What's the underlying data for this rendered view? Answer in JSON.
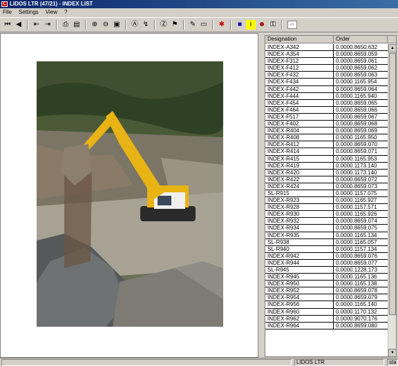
{
  "window": {
    "title": "LIDOS LTR (47/21) - INDEX LIST"
  },
  "menu": [
    "File",
    "Settings",
    "View",
    "?"
  ],
  "toolbar": {
    "icons": [
      "first-page-icon",
      "prev-page-icon",
      "prev-doc-icon",
      "next-doc-icon",
      "print-icon",
      "print-setup-icon",
      "zoom-in-icon",
      "zoom-out-icon",
      "fit-page-icon",
      "search-icon",
      "search-next-icon",
      "history-icon",
      "bookmark-icon",
      "note-icon",
      "export-icon",
      "highlight-icon",
      "info-icon",
      "settings-icon",
      "user-icon"
    ],
    "tab_glyph": "▭"
  },
  "list": {
    "headers": [
      "Designation",
      "Order"
    ],
    "rows": [
      [
        "INDEX-A342",
        "0.0000.8650.632"
      ],
      [
        "INDEX-A354",
        "0.0000.8659.059"
      ],
      [
        "INDEX-F312",
        "0.0000.8659.061"
      ],
      [
        "INDEX-F412",
        "0.0000.8659.062"
      ],
      [
        "INDEX-F432",
        "0.0000.8659.063"
      ],
      [
        "INDEX-F434",
        "0.0000.1165.954"
      ],
      [
        "INDEX-F442",
        "0.0000.8659.064"
      ],
      [
        "INDEX-F444",
        "0.0000.1165.940"
      ],
      [
        "INDEX-F454",
        "0.0000.8659.065"
      ],
      [
        "INDEX-F464",
        "0.0000.8659.066"
      ],
      [
        "INDEX-F517",
        "0.0000.8659.067"
      ],
      [
        "INDEX-F402",
        "0.0000.8659.068"
      ],
      [
        "INDEX-R404",
        "0.0000.8659.069"
      ],
      [
        "INDEX-R408",
        "0.0000.1165.950"
      ],
      [
        "INDEX-R412",
        "0.0000.8659.070"
      ],
      [
        "INDEX-R414",
        "0.0000.8659.071"
      ],
      [
        "INDEX-R415",
        "0.0000.1165.953"
      ],
      [
        "INDEX-R419",
        "0.0000.1173.140"
      ],
      [
        "INDEX-R420",
        "0.0000.1173.140"
      ],
      [
        "INDEX-R422",
        "0.0000.8659.072"
      ],
      [
        "INDEX-R424",
        "0.0000.8659.073"
      ],
      [
        "SL-R915",
        "0.0000.1157.075"
      ],
      [
        "INDEX-R923",
        "0.0000.1165.927"
      ],
      [
        "INDEX-R928",
        "0.0000.1157.571"
      ],
      [
        "INDEX-R930",
        "0.0000.1165.926"
      ],
      [
        "INDEX-R932",
        "0.0000.8659.074"
      ],
      [
        "INDEX-R934",
        "0.0000.8659.075"
      ],
      [
        "INDEX-R935",
        "0.0000.1165.134"
      ],
      [
        "SL-R938",
        "0.0000.1165.057"
      ],
      [
        "SL-R940",
        "0.0000.1157.134"
      ],
      [
        "INDEX-R942",
        "0.0000.8659.076"
      ],
      [
        "INDEX-R944",
        "0.0000.8659.077"
      ],
      [
        "SL-R945",
        "0.0000.1228.173"
      ],
      [
        "INDEX-R945",
        "0.0000.1165.136"
      ],
      [
        "INDEX-R950",
        "0.0000.1165.138"
      ],
      [
        "INDEX-R952",
        "0.0000.8659.078"
      ],
      [
        "INDEX-R954",
        "0.0000.8659.079"
      ],
      [
        "INDEX-R956",
        "0.0000.1165.140"
      ],
      [
        "INDEX-R960",
        "0.0000.1170.132"
      ],
      [
        "INDEX-R962",
        "0.0000.9070.176"
      ],
      [
        "INDEX-R964",
        "0.0000.8659.080"
      ]
    ]
  },
  "status": {
    "left": "",
    "middle": "LIDOS LTR",
    "right": "sta"
  }
}
